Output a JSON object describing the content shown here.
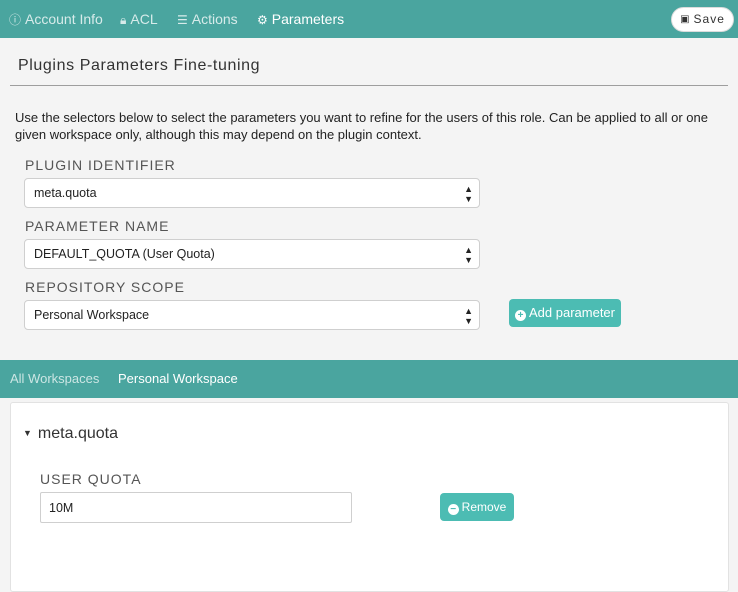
{
  "top_tabs": [
    {
      "label": "Account Info",
      "icon": "info-circle-icon"
    },
    {
      "label": "ACL",
      "icon": "lock-icon"
    },
    {
      "label": "Actions",
      "icon": "bars-icon"
    },
    {
      "label": "Parameters",
      "icon": "gear-icon"
    }
  ],
  "active_tab": "Parameters",
  "save_button": {
    "label": "Save",
    "icon": "floppy-disk-icon"
  },
  "section": {
    "title": "Plugins Parameters Fine-tuning",
    "intro": "Use the selectors below to select the parameters you want to refine for the users of this role. Can be applied to all or one given workspace only, although this may depend on the plugin context."
  },
  "form": {
    "plugin_label": "PLUGIN IDENTIFIER",
    "plugin_value": "meta.quota",
    "param_label": "PARAMETER NAME",
    "param_value": "DEFAULT_QUOTA (User Quota)",
    "scope_label": "REPOSITORY SCOPE",
    "scope_value": "Personal Workspace",
    "add_button": "Add parameter"
  },
  "workspace_tabs": [
    {
      "label": "All Workspaces"
    },
    {
      "label": "Personal Workspace"
    }
  ],
  "active_workspace": "Personal Workspace",
  "panel": {
    "plugin_name": "meta.quota",
    "param_label": "USER QUOTA",
    "param_value": "10M",
    "remove_button": "Remove"
  },
  "colors": {
    "accent": "#4aa59f",
    "button": "#4cbcb3"
  }
}
